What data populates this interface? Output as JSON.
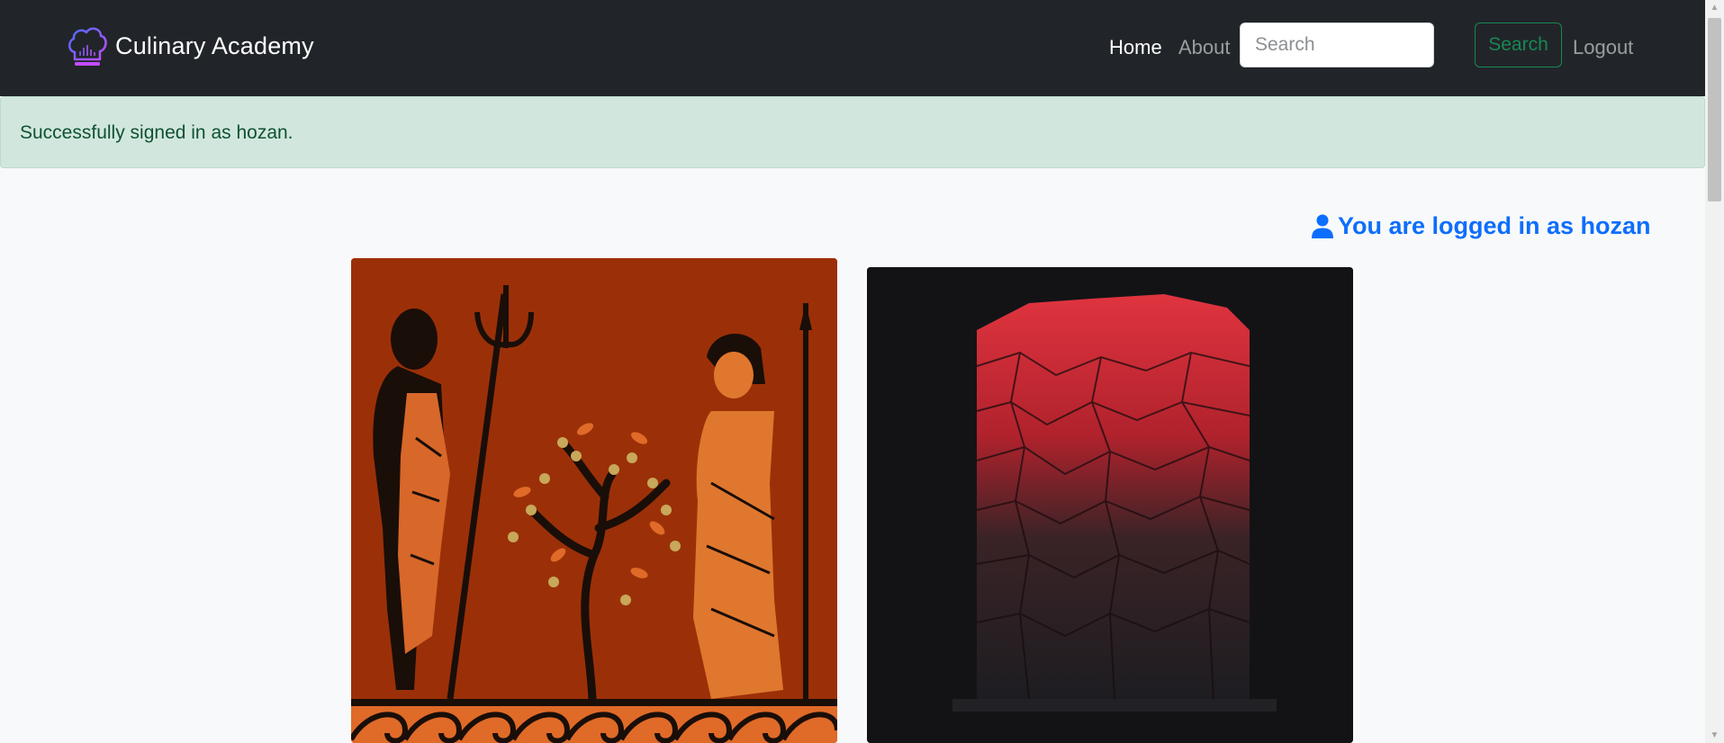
{
  "navbar": {
    "brand": "Culinary Academy",
    "brand_icon": "chef-hat-icon",
    "links": {
      "home": "Home",
      "about": "About",
      "logout": "Logout"
    },
    "search": {
      "placeholder": "Search",
      "value": "",
      "button_label": "Search"
    }
  },
  "alert": {
    "message": "Successfully signed in as hozan."
  },
  "main": {
    "logged_in_text": "You are logged in as hozan",
    "logged_in_icon": "user-icon",
    "cards": [
      {
        "image": "greek-vase-painting-poseidon-athena-olive-tree"
      },
      {
        "image": "red-and-black-cracked-stone-cake"
      }
    ]
  },
  "colors": {
    "navbar_bg": "#212529",
    "alert_bg": "#d1e7dd",
    "alert_text": "#0f5132",
    "link_accent": "#0d6efd",
    "search_button": "#198754"
  }
}
